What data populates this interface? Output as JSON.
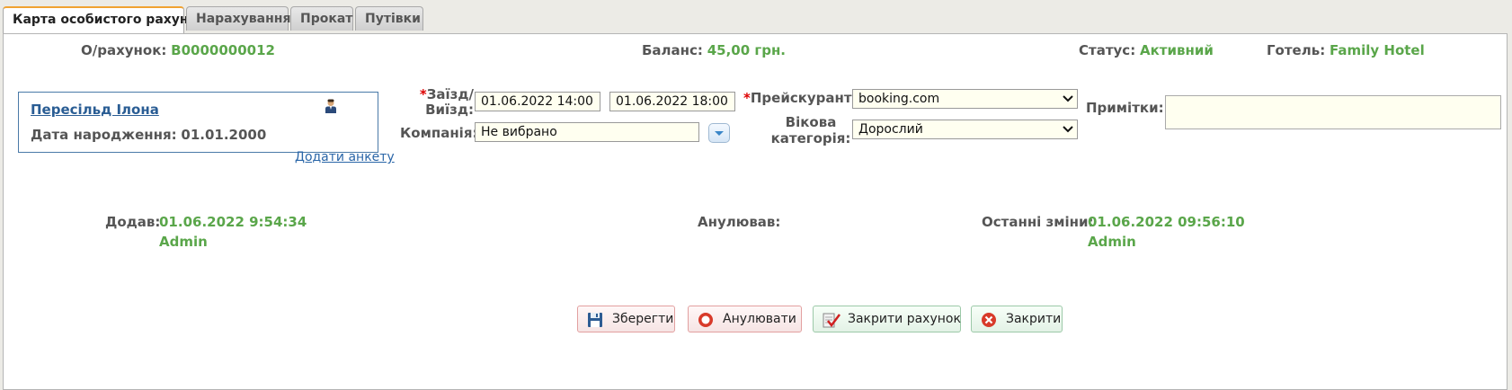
{
  "tabs": [
    "Карта особистого рахунку",
    "Нарахування",
    "Прокат",
    "Путівки"
  ],
  "header": {
    "account_label": "О/рахунок:",
    "account_value": "B0000000012",
    "balance_label": "Баланс:",
    "balance_value": "45,00 грн.",
    "status_label": "Статус:",
    "status_value": "Активний",
    "hotel_label": "Готель:",
    "hotel_value": "Family Hotel"
  },
  "guest": {
    "name": "Пересільд Ілона",
    "birth_label": "Дата народження:",
    "birth_value": "01.01.2000",
    "add_form_link": "Додати анкету"
  },
  "form": {
    "required_mark": "*",
    "checkin_label_1": "Заїзд/",
    "checkin_label_2": "Виїзд:",
    "checkin_value": "01.06.2022 14:00",
    "checkout_value": "01.06.2022 18:00",
    "company_label": "Компанія:",
    "company_value": "Не вибрано",
    "pricelist_label": "Прейскурант:",
    "pricelist_value": "booking.com",
    "age_label_1": "Вікова",
    "age_label_2": "категорія:",
    "age_value": "Дорослий",
    "notes_label": "Примітки:",
    "notes_value": ""
  },
  "audit": {
    "added_label": "Додав:",
    "added_date": "01.06.2022 9:54:34",
    "added_user": "Admin",
    "cancelled_label": "Анулював:",
    "changed_label": "Останні зміни:",
    "changed_date": "01.06.2022 09:56:10",
    "changed_user": "Admin"
  },
  "buttons": {
    "save": "Зберегти",
    "cancel": "Анулювати",
    "close_account": "Закрити рахунок",
    "close": "Закрити"
  },
  "colors": {
    "value_green": "#5aa64a",
    "link_blue": "#2a5d94",
    "active_tab_accent": "#f0a232",
    "required_red": "#dd0000"
  }
}
